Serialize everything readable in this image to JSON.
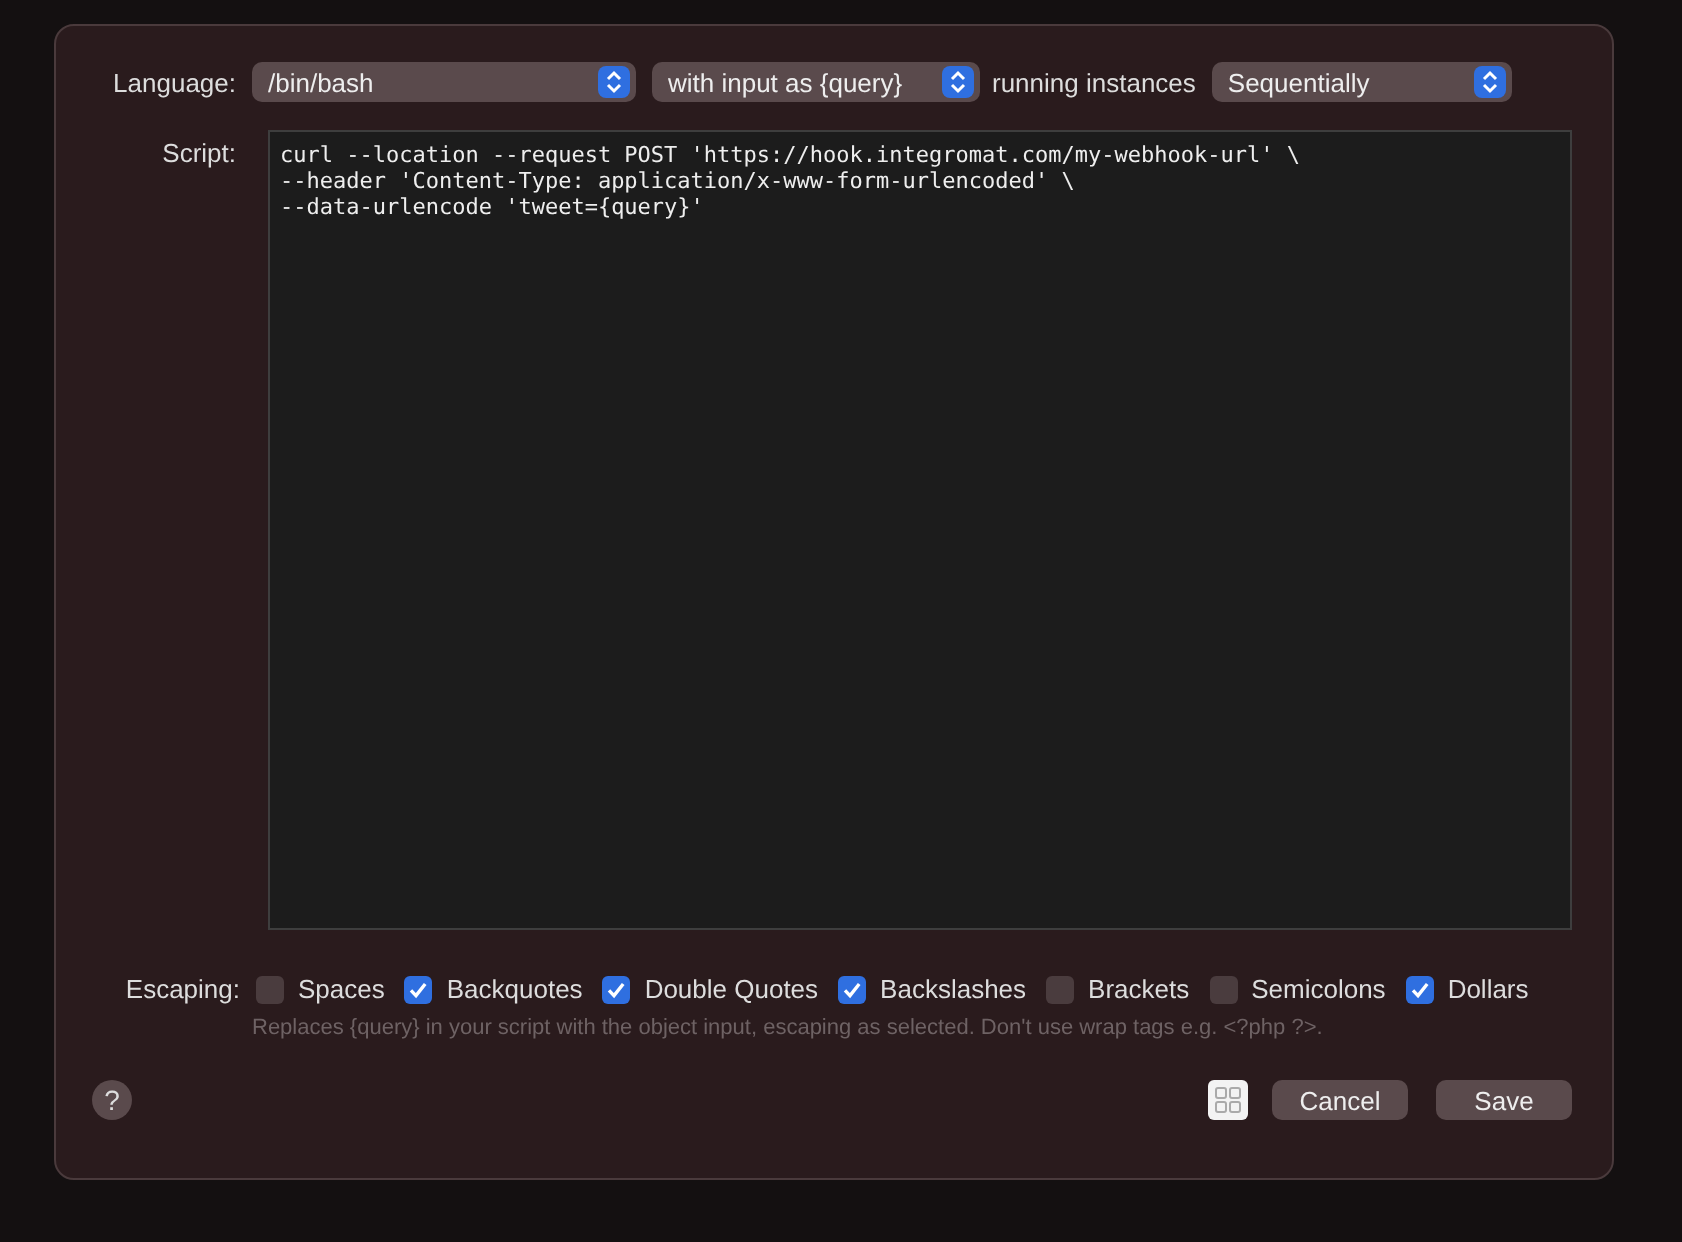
{
  "language": {
    "label": "Language:",
    "selects": [
      {
        "value": "/bin/bash"
      },
      {
        "value": "with input as {query}"
      }
    ],
    "instances_label": "running instances",
    "instances": {
      "value": "Sequentially"
    }
  },
  "script": {
    "label": "Script:",
    "lines": [
      "curl --location --request POST 'https://hook.integromat.com/my-webhook-url' \\",
      "--header 'Content-Type: application/x-www-form-urlencoded' \\",
      "--data-urlencode 'tweet={query}'"
    ]
  },
  "escaping": {
    "label": "Escaping:",
    "options": [
      {
        "label": "Spaces",
        "checked": false
      },
      {
        "label": "Backquotes",
        "checked": true
      },
      {
        "label": "Double Quotes",
        "checked": true
      },
      {
        "label": "Backslashes",
        "checked": true
      },
      {
        "label": "Brackets",
        "checked": false
      },
      {
        "label": "Semicolons",
        "checked": false
      },
      {
        "label": "Dollars",
        "checked": true
      }
    ],
    "hint": "Replaces {query} in your script with the object input, escaping as selected. Don't use wrap tags e.g. <?php ?>."
  },
  "help": "?",
  "buttons": [
    {
      "label": "Cancel"
    },
    {
      "label": "Save"
    }
  ]
}
